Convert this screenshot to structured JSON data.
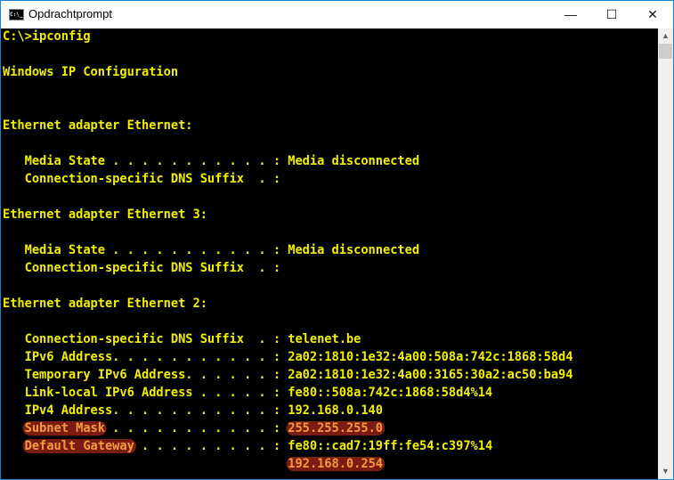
{
  "window": {
    "title": "Opdrachtprompt",
    "icon": "cmd-icon",
    "minimize": "—",
    "maximize": "☐",
    "close": "✕"
  },
  "lines": [
    [
      {
        "t": "C:\\>ipconfig"
      }
    ],
    [],
    [
      {
        "t": "Windows IP Configuration"
      }
    ],
    [],
    [],
    [
      {
        "t": "Ethernet adapter Ethernet:"
      }
    ],
    [],
    [
      {
        "t": "   Media State . . . . . . . . . . . : Media disconnected"
      }
    ],
    [
      {
        "t": "   Connection-specific DNS Suffix  . :"
      }
    ],
    [],
    [
      {
        "t": "Ethernet adapter Ethernet 3:"
      }
    ],
    [],
    [
      {
        "t": "   Media State . . . . . . . . . . . : Media disconnected"
      }
    ],
    [
      {
        "t": "   Connection-specific DNS Suffix  . :"
      }
    ],
    [],
    [
      {
        "t": "Ethernet adapter Ethernet 2:"
      }
    ],
    [],
    [
      {
        "t": "   Connection-specific DNS Suffix  . : telenet.be"
      }
    ],
    [
      {
        "t": "   IPv6 Address. . . . . . . . . . . : 2a02:1810:1e32:4a00:508a:742c:1868:58d4"
      }
    ],
    [
      {
        "t": "   Temporary IPv6 Address. . . . . . : 2a02:1810:1e32:4a00:3165:30a2:ac50:ba94"
      }
    ],
    [
      {
        "t": "   Link-local IPv6 Address . . . . . : fe80::508a:742c:1868:58d4%14"
      }
    ],
    [
      {
        "t": "   IPv4 Address. . . . . . . . . . . : 192.168.0.140"
      }
    ],
    [
      {
        "t": "   "
      },
      {
        "t": "Subnet Mask",
        "hl": true
      },
      {
        "t": " . . . . . . . . . . . : "
      },
      {
        "t": "255.255.255.0",
        "hl": true
      }
    ],
    [
      {
        "t": "   "
      },
      {
        "t": "Default Gateway",
        "hl": true
      },
      {
        "t": " . . . . . . . . . : fe80::cad7:19ff:fe54:c397%14"
      }
    ],
    [
      {
        "t": "                                       "
      },
      {
        "t": "192.168.0.254",
        "hl": true
      }
    ]
  ],
  "scrollbar": {
    "up": "▲",
    "down": "▼"
  }
}
